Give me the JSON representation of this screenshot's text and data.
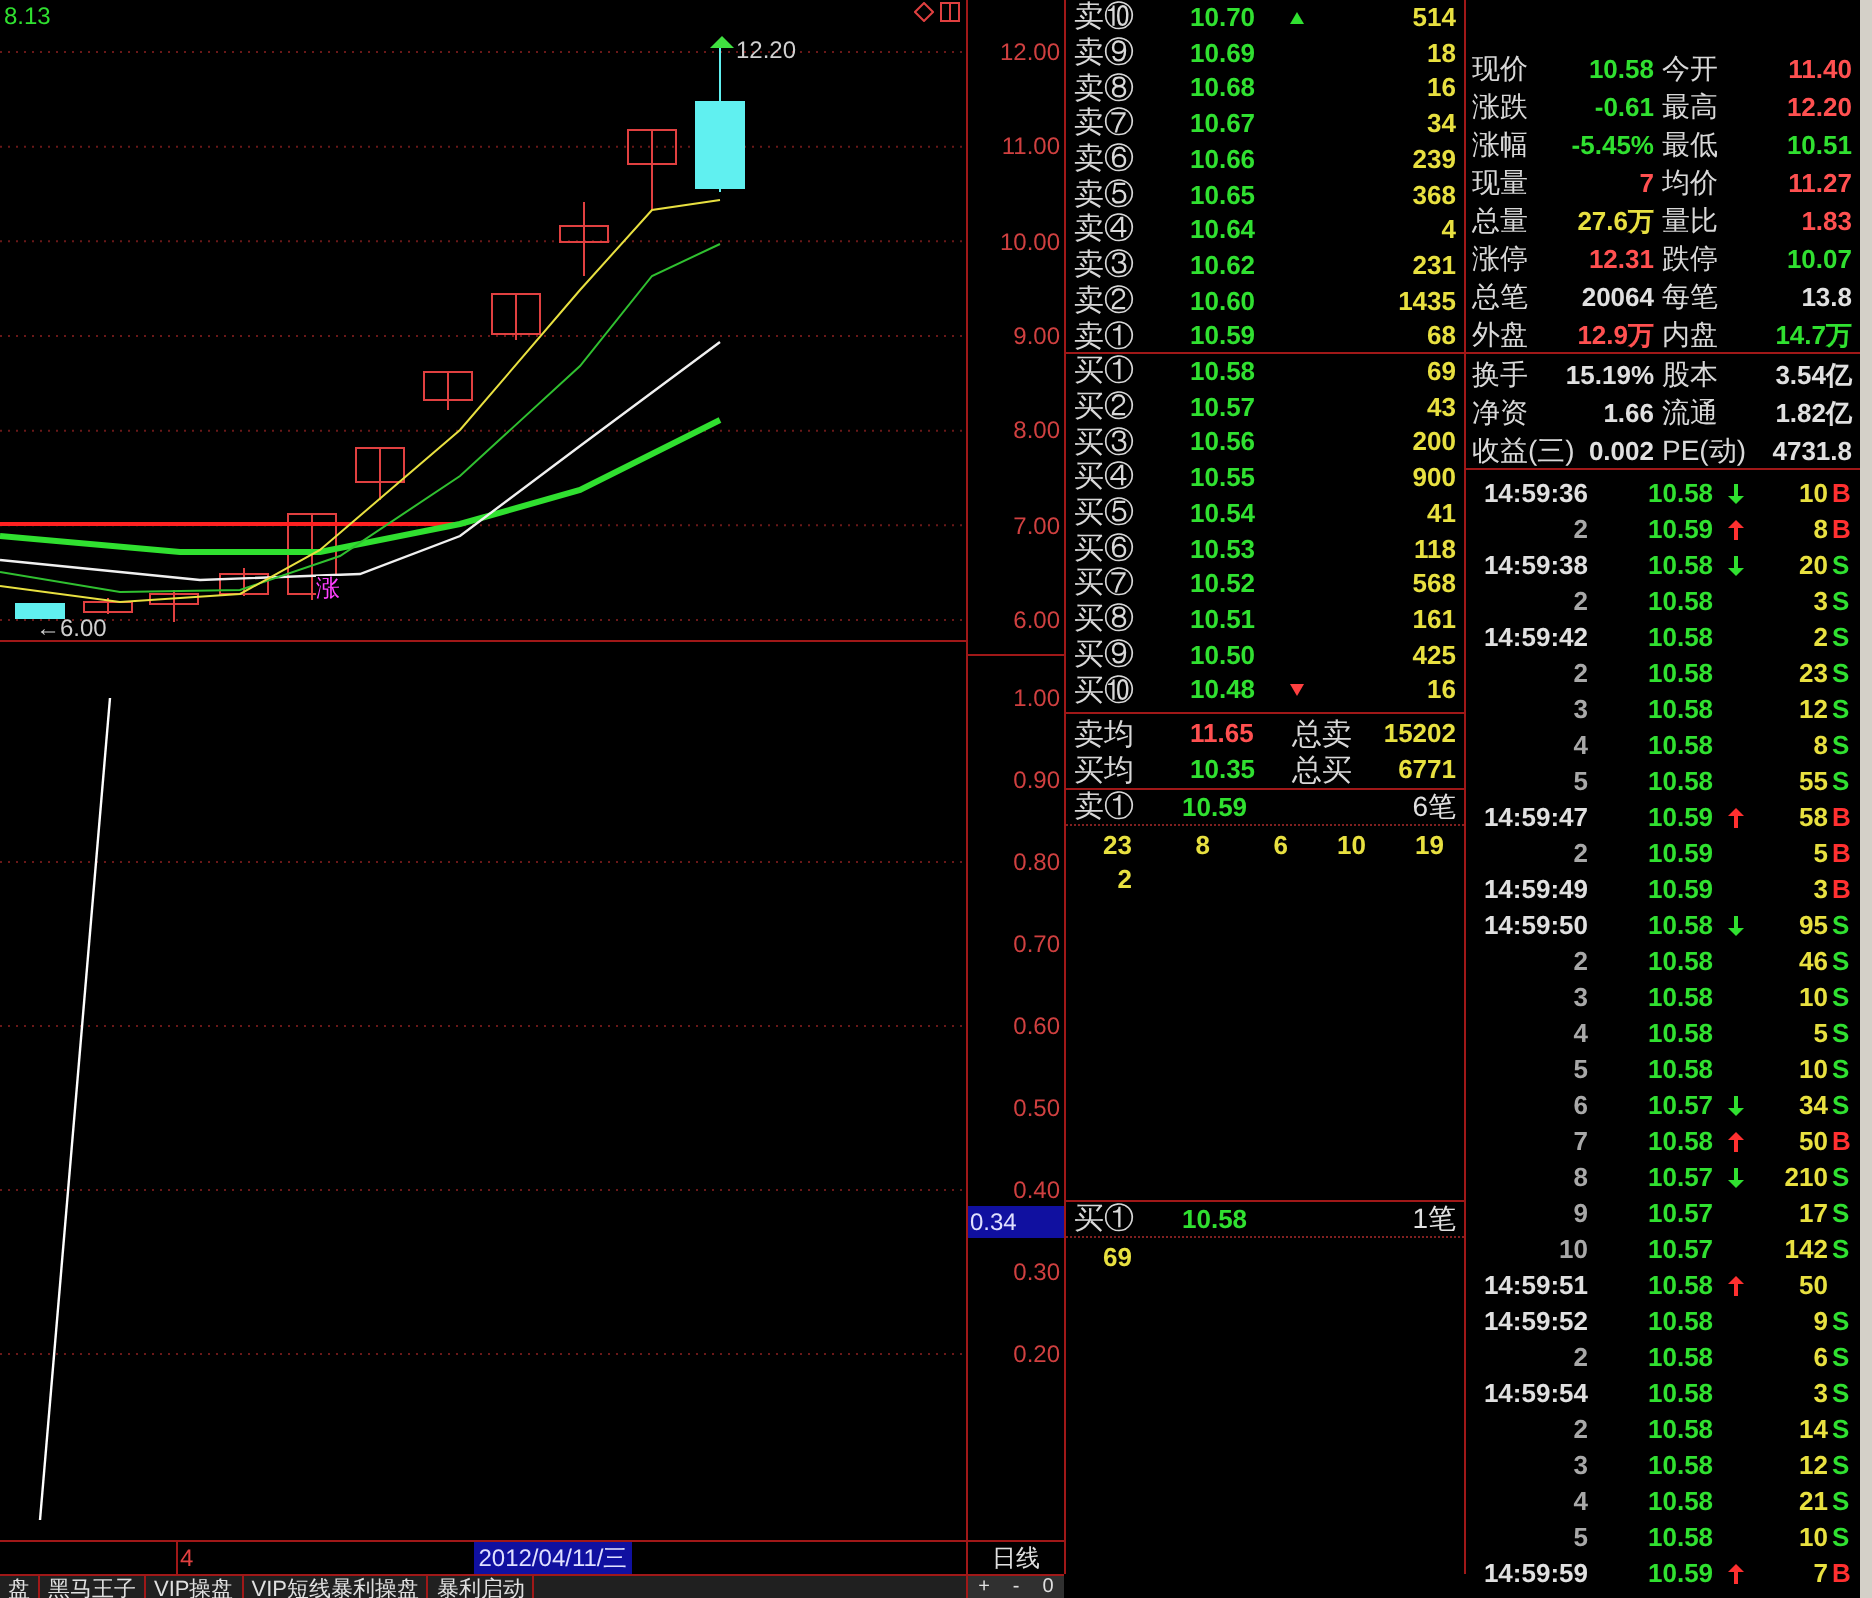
{
  "price_chart": {
    "indicator_value": "8.13",
    "high_label": "12.20",
    "low_label": "←6.00",
    "signal_label": "涨",
    "y_ticks": [
      "12.00",
      "11.00",
      "10.00",
      "9.00",
      "8.00",
      "7.00",
      "6.00"
    ]
  },
  "indicator_chart": {
    "y_ticks": [
      "1.00",
      "0.90",
      "0.80",
      "0.70",
      "0.60",
      "0.50",
      "0.40",
      "0.30",
      "0.20"
    ],
    "current_value": "0.34"
  },
  "date_bar": {
    "bar_count": "4",
    "cursor_date": "2012/04/11/三",
    "period": "日线"
  },
  "bottom_tabs": [
    {
      "label": "盘"
    },
    {
      "label": "黑马王子"
    },
    {
      "label": "VIP操盘"
    },
    {
      "label": "VIP短线暴利操盘"
    },
    {
      "label": "暴利启动"
    }
  ],
  "zoom_buttons": [
    "+",
    "-",
    "0"
  ],
  "order_book": {
    "asks": [
      {
        "label": "卖⑩",
        "price": "10.70",
        "size": "514",
        "up_mark": true
      },
      {
        "label": "卖⑨",
        "price": "10.69",
        "size": "18",
        "up_mark": false
      },
      {
        "label": "卖⑧",
        "price": "10.68",
        "size": "16",
        "up_mark": false
      },
      {
        "label": "卖⑦",
        "price": "10.67",
        "size": "34",
        "up_mark": false
      },
      {
        "label": "卖⑥",
        "price": "10.66",
        "size": "239",
        "up_mark": false
      },
      {
        "label": "卖⑤",
        "price": "10.65",
        "size": "368",
        "up_mark": false
      },
      {
        "label": "卖④",
        "price": "10.64",
        "size": "4",
        "up_mark": false
      },
      {
        "label": "卖③",
        "price": "10.62",
        "size": "231",
        "up_mark": false
      },
      {
        "label": "卖②",
        "price": "10.60",
        "size": "1435",
        "up_mark": false
      },
      {
        "label": "卖①",
        "price": "10.59",
        "size": "68",
        "up_mark": false
      }
    ],
    "bids": [
      {
        "label": "买①",
        "price": "10.58",
        "size": "69",
        "down_mark": false
      },
      {
        "label": "买②",
        "price": "10.57",
        "size": "43",
        "down_mark": false
      },
      {
        "label": "买③",
        "price": "10.56",
        "size": "200",
        "down_mark": false
      },
      {
        "label": "买④",
        "price": "10.55",
        "size": "900",
        "down_mark": false
      },
      {
        "label": "买⑤",
        "price": "10.54",
        "size": "41",
        "down_mark": false
      },
      {
        "label": "买⑥",
        "price": "10.53",
        "size": "118",
        "down_mark": false
      },
      {
        "label": "买⑦",
        "price": "10.52",
        "size": "568",
        "down_mark": false
      },
      {
        "label": "买⑧",
        "price": "10.51",
        "size": "161",
        "down_mark": false
      },
      {
        "label": "买⑨",
        "price": "10.50",
        "size": "425",
        "down_mark": false
      },
      {
        "label": "买⑩",
        "price": "10.48",
        "size": "16",
        "down_mark": true
      }
    ],
    "summary": [
      {
        "label": "卖均",
        "price": "11.65",
        "color": "#ff5050",
        "total_label": "总卖",
        "total": "15202"
      },
      {
        "label": "买均",
        "price": "10.35",
        "color": "#30e030",
        "total_label": "总买",
        "total": "6771"
      }
    ],
    "queues": [
      {
        "label": "卖①",
        "price": "10.59",
        "count": "6笔",
        "orders": [
          "23",
          "8",
          "6",
          "10",
          "19",
          "2"
        ]
      },
      {
        "label": "买①",
        "price": "10.58",
        "count": "1笔",
        "orders": [
          "69"
        ]
      }
    ]
  },
  "quote": {
    "price_rows": [
      [
        {
          "label": "现价",
          "value": "10.58",
          "color": "#30e030"
        },
        {
          "label": "今开",
          "value": "11.40",
          "color": "#ff5050"
        }
      ],
      [
        {
          "label": "涨跌",
          "value": "-0.61",
          "color": "#30e030"
        },
        {
          "label": "最高",
          "value": "12.20",
          "color": "#ff5050"
        }
      ],
      [
        {
          "label": "涨幅",
          "value": "-5.45%",
          "color": "#30e030"
        },
        {
          "label": "最低",
          "value": "10.51",
          "color": "#30e030"
        }
      ],
      [
        {
          "label": "现量",
          "value": "7",
          "color": "#ff5050"
        },
        {
          "label": "均价",
          "value": "11.27",
          "color": "#ff5050"
        }
      ],
      [
        {
          "label": "总量",
          "value": "27.6万",
          "color": "#e8e040"
        },
        {
          "label": "量比",
          "value": "1.83",
          "color": "#ff5050"
        }
      ],
      [
        {
          "label": "涨停",
          "value": "12.31",
          "color": "#ff5050"
        },
        {
          "label": "跌停",
          "value": "10.07",
          "color": "#30e030"
        }
      ],
      [
        {
          "label": "总笔",
          "value": "20064",
          "color": "#e0e0e0"
        },
        {
          "label": "每笔",
          "value": "13.8",
          "color": "#e0e0e0"
        }
      ],
      [
        {
          "label": "外盘",
          "value": "12.9万",
          "color": "#ff5050"
        },
        {
          "label": "内盘",
          "value": "14.7万",
          "color": "#30e030"
        }
      ]
    ],
    "fundamental_rows": [
      [
        {
          "label": "换手",
          "value": "15.19%",
          "color": "#e0e0e0"
        },
        {
          "label": "股本",
          "value": "3.54亿",
          "color": "#e0e0e0"
        }
      ],
      [
        {
          "label": "净资",
          "value": "1.66",
          "color": "#e0e0e0"
        },
        {
          "label": "流通",
          "value": "1.82亿",
          "color": "#e0e0e0"
        }
      ],
      [
        {
          "label": "收益(三)",
          "value": "0.002",
          "color": "#e0e0e0"
        },
        {
          "label": "PE(动)",
          "value": "4731.8",
          "color": "#e0e0e0"
        }
      ]
    ]
  },
  "ticks": [
    {
      "time": "14:59:36",
      "kind": "first",
      "price": "10.58",
      "up_arrow": false,
      "down_arrow": true,
      "volume": "10",
      "side": "B",
      "color": "#ff3030"
    },
    {
      "time": "2",
      "kind": "continued",
      "price": "10.59",
      "up_arrow": true,
      "down_arrow": false,
      "volume": "8",
      "side": "B",
      "color": "#ff3030"
    },
    {
      "time": "14:59:38",
      "kind": "first",
      "price": "10.58",
      "up_arrow": false,
      "down_arrow": true,
      "volume": "20",
      "side": "S",
      "color": "#30e030"
    },
    {
      "time": "2",
      "kind": "continued",
      "price": "10.58",
      "up_arrow": false,
      "down_arrow": false,
      "volume": "3",
      "side": "S",
      "color": "#30e030"
    },
    {
      "time": "14:59:42",
      "kind": "first",
      "price": "10.58",
      "up_arrow": false,
      "down_arrow": false,
      "volume": "2",
      "side": "S",
      "color": "#30e030"
    },
    {
      "time": "2",
      "kind": "continued",
      "price": "10.58",
      "up_arrow": false,
      "down_arrow": false,
      "volume": "23",
      "side": "S",
      "color": "#30e030"
    },
    {
      "time": "3",
      "kind": "continued",
      "price": "10.58",
      "up_arrow": false,
      "down_arrow": false,
      "volume": "12",
      "side": "S",
      "color": "#30e030"
    },
    {
      "time": "4",
      "kind": "continued",
      "price": "10.58",
      "up_arrow": false,
      "down_arrow": false,
      "volume": "8",
      "side": "S",
      "color": "#30e030"
    },
    {
      "time": "5",
      "kind": "continued",
      "price": "10.58",
      "up_arrow": false,
      "down_arrow": false,
      "volume": "55",
      "side": "S",
      "color": "#30e030"
    },
    {
      "time": "14:59:47",
      "kind": "first",
      "price": "10.59",
      "up_arrow": true,
      "down_arrow": false,
      "volume": "58",
      "side": "B",
      "color": "#ff3030"
    },
    {
      "time": "2",
      "kind": "continued",
      "price": "10.59",
      "up_arrow": false,
      "down_arrow": false,
      "volume": "5",
      "side": "B",
      "color": "#ff3030"
    },
    {
      "time": "14:59:49",
      "kind": "first",
      "price": "10.59",
      "up_arrow": false,
      "down_arrow": false,
      "volume": "3",
      "side": "B",
      "color": "#ff3030"
    },
    {
      "time": "14:59:50",
      "kind": "first",
      "price": "10.58",
      "up_arrow": false,
      "down_arrow": true,
      "volume": "95",
      "side": "S",
      "color": "#30e030"
    },
    {
      "time": "2",
      "kind": "continued",
      "price": "10.58",
      "up_arrow": false,
      "down_arrow": false,
      "volume": "46",
      "side": "S",
      "color": "#30e030"
    },
    {
      "time": "3",
      "kind": "continued",
      "price": "10.58",
      "up_arrow": false,
      "down_arrow": false,
      "volume": "10",
      "side": "S",
      "color": "#30e030"
    },
    {
      "time": "4",
      "kind": "continued",
      "price": "10.58",
      "up_arrow": false,
      "down_arrow": false,
      "volume": "5",
      "side": "S",
      "color": "#30e030"
    },
    {
      "time": "5",
      "kind": "continued",
      "price": "10.58",
      "up_arrow": false,
      "down_arrow": false,
      "volume": "10",
      "side": "S",
      "color": "#30e030"
    },
    {
      "time": "6",
      "kind": "continued",
      "price": "10.57",
      "up_arrow": false,
      "down_arrow": true,
      "volume": "34",
      "side": "S",
      "color": "#30e030"
    },
    {
      "time": "7",
      "kind": "continued",
      "price": "10.58",
      "up_arrow": true,
      "down_arrow": false,
      "volume": "50",
      "side": "B",
      "color": "#ff3030"
    },
    {
      "time": "8",
      "kind": "continued",
      "price": "10.57",
      "up_arrow": false,
      "down_arrow": true,
      "volume": "210",
      "side": "S",
      "color": "#30e030"
    },
    {
      "time": "9",
      "kind": "continued",
      "price": "10.57",
      "up_arrow": false,
      "down_arrow": false,
      "volume": "17",
      "side": "S",
      "color": "#30e030"
    },
    {
      "time": "10",
      "kind": "continued",
      "price": "10.57",
      "up_arrow": false,
      "down_arrow": false,
      "volume": "142",
      "side": "S",
      "color": "#30e030"
    },
    {
      "time": "14:59:51",
      "kind": "first",
      "price": "10.58",
      "up_arrow": true,
      "down_arrow": false,
      "volume": "50"
    },
    {
      "time": "14:59:52",
      "kind": "first",
      "price": "10.58",
      "up_arrow": false,
      "down_arrow": false,
      "volume": "9",
      "side": "S",
      "color": "#30e030"
    },
    {
      "time": "2",
      "kind": "continued",
      "price": "10.58",
      "up_arrow": false,
      "down_arrow": false,
      "volume": "6",
      "side": "S",
      "color": "#30e030"
    },
    {
      "time": "14:59:54",
      "kind": "first",
      "price": "10.58",
      "up_arrow": false,
      "down_arrow": false,
      "volume": "3",
      "side": "S",
      "color": "#30e030"
    },
    {
      "time": "2",
      "kind": "continued",
      "price": "10.58",
      "up_arrow": false,
      "down_arrow": false,
      "volume": "14",
      "side": "S",
      "color": "#30e030"
    },
    {
      "time": "3",
      "kind": "continued",
      "price": "10.58",
      "up_arrow": false,
      "down_arrow": false,
      "volume": "12",
      "side": "S",
      "color": "#30e030"
    },
    {
      "time": "4",
      "kind": "continued",
      "price": "10.58",
      "up_arrow": false,
      "down_arrow": false,
      "volume": "21",
      "side": "S",
      "color": "#30e030"
    },
    {
      "time": "5",
      "kind": "continued",
      "price": "10.58",
      "up_arrow": false,
      "down_arrow": false,
      "volume": "10",
      "side": "S",
      "color": "#30e030"
    },
    {
      "time": "14:59:59",
      "kind": "first",
      "price": "10.59",
      "up_arrow": true,
      "down_arrow": false,
      "volume": "7",
      "side": "B",
      "color": "#ff3030"
    }
  ]
}
